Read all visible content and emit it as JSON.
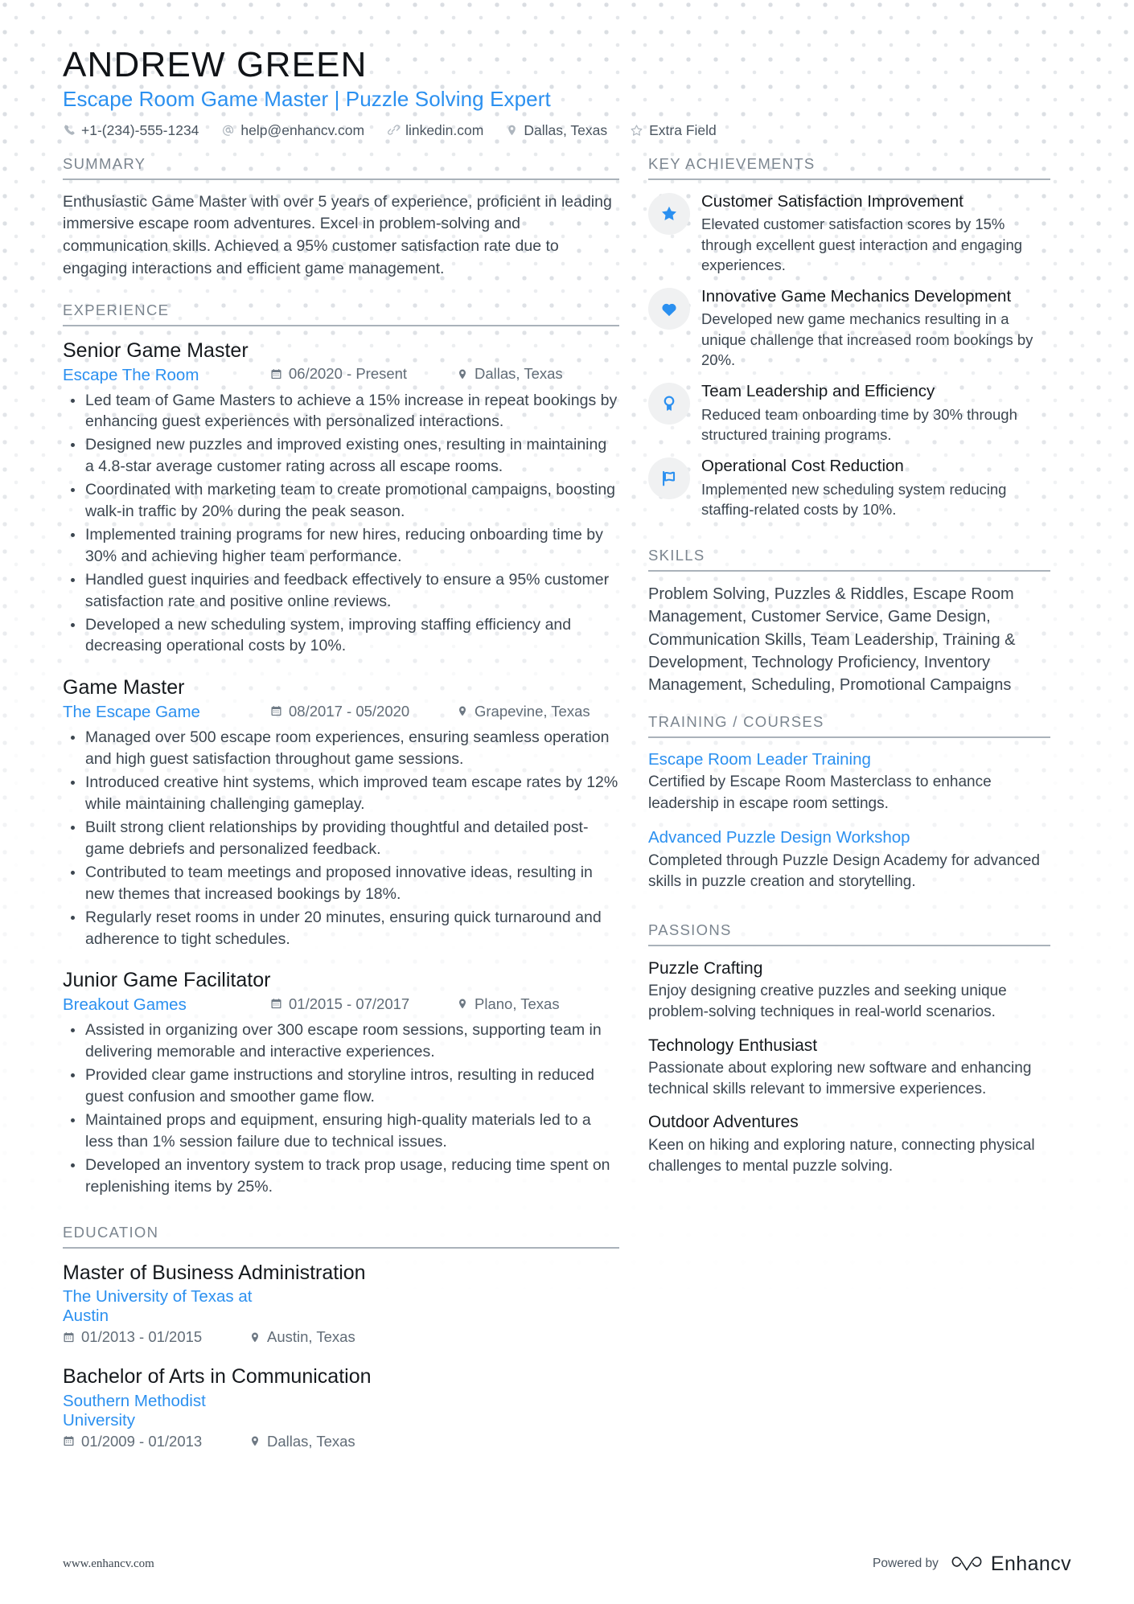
{
  "header": {
    "name": "ANDREW GREEN",
    "headline": "Escape Room Game Master | Puzzle Solving Expert",
    "contacts": [
      {
        "icon": "phone-icon",
        "text": "+1-(234)-555-1234"
      },
      {
        "icon": "email-icon",
        "text": "help@enhancv.com"
      },
      {
        "icon": "link-icon",
        "text": "linkedin.com"
      },
      {
        "icon": "location-pin-icon",
        "text": "Dallas, Texas"
      },
      {
        "icon": "star-outline-icon",
        "text": "Extra Field"
      }
    ]
  },
  "sections": {
    "summary_title": "SUMMARY",
    "experience_title": "EXPERIENCE",
    "education_title": "EDUCATION",
    "key_achievements_title": "KEY ACHIEVEMENTS",
    "skills_title": "SKILLS",
    "training_title": "TRAINING / COURSES",
    "passions_title": "PASSIONS"
  },
  "summary": {
    "text": "Enthusiastic Game Master with over 5 years of experience, proficient in leading immersive escape room adventures. Excel in problem-solving and communication skills. Achieved a 95% customer satisfaction rate due to engaging interactions and efficient game management."
  },
  "experience": [
    {
      "title": "Senior Game Master",
      "org": "Escape The Room",
      "date": "06/2020 - Present",
      "location": "Dallas, Texas",
      "bullets": [
        "Led team of Game Masters to achieve a 15% increase in repeat bookings by enhancing guest experiences with personalized interactions.",
        "Designed new puzzles and improved existing ones, resulting in maintaining a 4.8-star average customer rating across all escape rooms.",
        "Coordinated with marketing team to create promotional campaigns, boosting walk-in traffic by 20% during the peak season.",
        "Implemented training programs for new hires, reducing onboarding time by 30% and achieving higher team performance.",
        "Handled guest inquiries and feedback effectively to ensure a 95% customer satisfaction rate and positive online reviews.",
        "Developed a new scheduling system, improving staffing efficiency and decreasing operational costs by 10%."
      ]
    },
    {
      "title": "Game Master",
      "org": "The Escape Game",
      "date": "08/2017 - 05/2020",
      "location": "Grapevine, Texas",
      "bullets": [
        "Managed over 500 escape room experiences, ensuring seamless operation and high guest satisfaction throughout game sessions.",
        "Introduced creative hint systems, which improved team escape rates by 12% while maintaining challenging gameplay.",
        "Built strong client relationships by providing thoughtful and detailed post-game debriefs and personalized feedback.",
        "Contributed to team meetings and proposed innovative ideas, resulting in new themes that increased bookings by 18%.",
        "Regularly reset rooms in under 20 minutes, ensuring quick turnaround and adherence to tight schedules."
      ]
    },
    {
      "title": "Junior Game Facilitator",
      "org": "Breakout Games",
      "date": "01/2015 - 07/2017",
      "location": "Plano, Texas",
      "bullets": [
        "Assisted in organizing over 300 escape room sessions, supporting team in delivering memorable and interactive experiences.",
        "Provided clear game instructions and storyline intros, resulting in reduced guest confusion and smoother game flow.",
        "Maintained props and equipment, ensuring high-quality materials led to a less than 1% session failure due to technical issues.",
        "Developed an inventory system to track prop usage, reducing time spent on replenishing items by 25%."
      ]
    }
  ],
  "education": [
    {
      "title": "Master of Business Administration",
      "org": "The University of Texas at Austin",
      "date": "01/2013 - 01/2015",
      "location": "Austin, Texas"
    },
    {
      "title": "Bachelor of Arts in Communication",
      "org": "Southern Methodist University",
      "date": "01/2009 - 01/2013",
      "location": "Dallas, Texas"
    }
  ],
  "key_achievements": [
    {
      "icon": "star-icon",
      "title": "Customer Satisfaction Improvement",
      "desc": "Elevated customer satisfaction scores by 15% through excellent guest interaction and engaging experiences."
    },
    {
      "icon": "heart-icon",
      "title": "Innovative Game Mechanics Development",
      "desc": "Developed new game mechanics resulting in a unique challenge that increased room bookings by 20%."
    },
    {
      "icon": "badge-pin-icon",
      "title": "Team Leadership and Efficiency",
      "desc": "Reduced team onboarding time by 30% through structured training programs."
    },
    {
      "icon": "flag-icon",
      "title": "Operational Cost Reduction",
      "desc": "Implemented new scheduling system reducing staffing-related costs by 10%."
    }
  ],
  "skills": {
    "text": "Problem Solving, Puzzles & Riddles, Escape Room Management, Customer Service, Game Design, Communication Skills, Team Leadership, Training & Development, Technology Proficiency, Inventory Management, Scheduling, Promotional Campaigns"
  },
  "training": [
    {
      "title": "Escape Room Leader Training",
      "desc": "Certified by Escape Room Masterclass to enhance leadership in escape room settings."
    },
    {
      "title": "Advanced Puzzle Design Workshop",
      "desc": "Completed through Puzzle Design Academy for advanced skills in puzzle creation and storytelling."
    }
  ],
  "passions": [
    {
      "title": "Puzzle Crafting",
      "desc": "Enjoy designing creative puzzles and seeking unique problem-solving techniques in real-world scenarios."
    },
    {
      "title": "Technology Enthusiast",
      "desc": "Passionate about exploring new software and enhancing technical skills relevant to immersive experiences."
    },
    {
      "title": "Outdoor Adventures",
      "desc": "Keen on hiking and exploring nature, connecting physical challenges to mental puzzle solving."
    }
  ],
  "footer": {
    "url": "www.enhancv.com",
    "powered_by": "Powered by",
    "brand": "Enhancv"
  },
  "colors": {
    "accent": "#2b90f0",
    "text": "#3c4650",
    "heading": "#7b858f",
    "rule": "#aab2ba"
  }
}
